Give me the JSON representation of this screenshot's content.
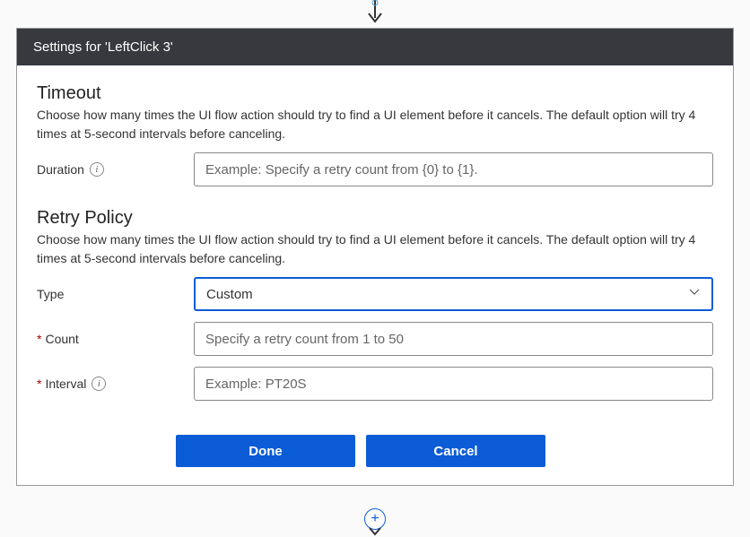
{
  "header": {
    "title": "Settings for 'LeftClick 3'"
  },
  "timeout": {
    "title": "Timeout",
    "desc": "Choose how many times the UI flow action should try to find a UI element before it cancels. The default option will try 4 times at 5-second intervals before canceling.",
    "duration_label": "Duration",
    "duration_placeholder": "Example: Specify a retry count from {0} to {1}."
  },
  "retry": {
    "title": "Retry Policy",
    "desc": "Choose how many times the UI flow action should try to find a UI element before it cancels. The default option will try 4 times at 5-second intervals before canceling.",
    "type_label": "Type",
    "type_value": "Custom",
    "count_label": "Count",
    "count_placeholder": "Specify a retry count from 1 to 50",
    "interval_label": "Interval",
    "interval_placeholder": "Example: PT20S"
  },
  "buttons": {
    "done": "Done",
    "cancel": "Cancel"
  }
}
